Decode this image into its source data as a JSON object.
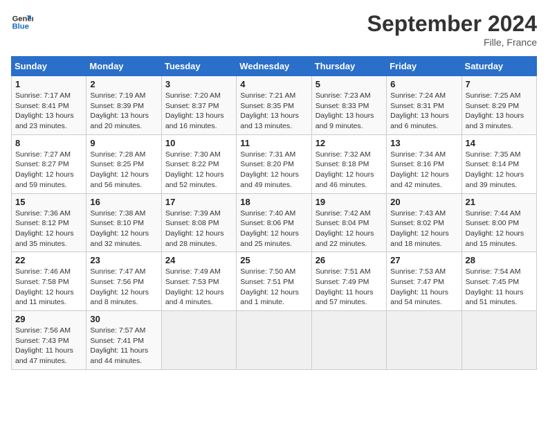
{
  "header": {
    "logo_line1": "General",
    "logo_line2": "Blue",
    "month": "September 2024",
    "location": "Fille, France"
  },
  "weekdays": [
    "Sunday",
    "Monday",
    "Tuesday",
    "Wednesday",
    "Thursday",
    "Friday",
    "Saturday"
  ],
  "weeks": [
    [
      {
        "day": "1",
        "detail": "Sunrise: 7:17 AM\nSunset: 8:41 PM\nDaylight: 13 hours\nand 23 minutes."
      },
      {
        "day": "2",
        "detail": "Sunrise: 7:19 AM\nSunset: 8:39 PM\nDaylight: 13 hours\nand 20 minutes."
      },
      {
        "day": "3",
        "detail": "Sunrise: 7:20 AM\nSunset: 8:37 PM\nDaylight: 13 hours\nand 16 minutes."
      },
      {
        "day": "4",
        "detail": "Sunrise: 7:21 AM\nSunset: 8:35 PM\nDaylight: 13 hours\nand 13 minutes."
      },
      {
        "day": "5",
        "detail": "Sunrise: 7:23 AM\nSunset: 8:33 PM\nDaylight: 13 hours\nand 9 minutes."
      },
      {
        "day": "6",
        "detail": "Sunrise: 7:24 AM\nSunset: 8:31 PM\nDaylight: 13 hours\nand 6 minutes."
      },
      {
        "day": "7",
        "detail": "Sunrise: 7:25 AM\nSunset: 8:29 PM\nDaylight: 13 hours\nand 3 minutes."
      }
    ],
    [
      {
        "day": "8",
        "detail": "Sunrise: 7:27 AM\nSunset: 8:27 PM\nDaylight: 12 hours\nand 59 minutes."
      },
      {
        "day": "9",
        "detail": "Sunrise: 7:28 AM\nSunset: 8:25 PM\nDaylight: 12 hours\nand 56 minutes."
      },
      {
        "day": "10",
        "detail": "Sunrise: 7:30 AM\nSunset: 8:22 PM\nDaylight: 12 hours\nand 52 minutes."
      },
      {
        "day": "11",
        "detail": "Sunrise: 7:31 AM\nSunset: 8:20 PM\nDaylight: 12 hours\nand 49 minutes."
      },
      {
        "day": "12",
        "detail": "Sunrise: 7:32 AM\nSunset: 8:18 PM\nDaylight: 12 hours\nand 46 minutes."
      },
      {
        "day": "13",
        "detail": "Sunrise: 7:34 AM\nSunset: 8:16 PM\nDaylight: 12 hours\nand 42 minutes."
      },
      {
        "day": "14",
        "detail": "Sunrise: 7:35 AM\nSunset: 8:14 PM\nDaylight: 12 hours\nand 39 minutes."
      }
    ],
    [
      {
        "day": "15",
        "detail": "Sunrise: 7:36 AM\nSunset: 8:12 PM\nDaylight: 12 hours\nand 35 minutes."
      },
      {
        "day": "16",
        "detail": "Sunrise: 7:38 AM\nSunset: 8:10 PM\nDaylight: 12 hours\nand 32 minutes."
      },
      {
        "day": "17",
        "detail": "Sunrise: 7:39 AM\nSunset: 8:08 PM\nDaylight: 12 hours\nand 28 minutes."
      },
      {
        "day": "18",
        "detail": "Sunrise: 7:40 AM\nSunset: 8:06 PM\nDaylight: 12 hours\nand 25 minutes."
      },
      {
        "day": "19",
        "detail": "Sunrise: 7:42 AM\nSunset: 8:04 PM\nDaylight: 12 hours\nand 22 minutes."
      },
      {
        "day": "20",
        "detail": "Sunrise: 7:43 AM\nSunset: 8:02 PM\nDaylight: 12 hours\nand 18 minutes."
      },
      {
        "day": "21",
        "detail": "Sunrise: 7:44 AM\nSunset: 8:00 PM\nDaylight: 12 hours\nand 15 minutes."
      }
    ],
    [
      {
        "day": "22",
        "detail": "Sunrise: 7:46 AM\nSunset: 7:58 PM\nDaylight: 12 hours\nand 11 minutes."
      },
      {
        "day": "23",
        "detail": "Sunrise: 7:47 AM\nSunset: 7:56 PM\nDaylight: 12 hours\nand 8 minutes."
      },
      {
        "day": "24",
        "detail": "Sunrise: 7:49 AM\nSunset: 7:53 PM\nDaylight: 12 hours\nand 4 minutes."
      },
      {
        "day": "25",
        "detail": "Sunrise: 7:50 AM\nSunset: 7:51 PM\nDaylight: 12 hours\nand 1 minute."
      },
      {
        "day": "26",
        "detail": "Sunrise: 7:51 AM\nSunset: 7:49 PM\nDaylight: 11 hours\nand 57 minutes."
      },
      {
        "day": "27",
        "detail": "Sunrise: 7:53 AM\nSunset: 7:47 PM\nDaylight: 11 hours\nand 54 minutes."
      },
      {
        "day": "28",
        "detail": "Sunrise: 7:54 AM\nSunset: 7:45 PM\nDaylight: 11 hours\nand 51 minutes."
      }
    ],
    [
      {
        "day": "29",
        "detail": "Sunrise: 7:56 AM\nSunset: 7:43 PM\nDaylight: 11 hours\nand 47 minutes."
      },
      {
        "day": "30",
        "detail": "Sunrise: 7:57 AM\nSunset: 7:41 PM\nDaylight: 11 hours\nand 44 minutes."
      },
      {
        "day": "",
        "detail": ""
      },
      {
        "day": "",
        "detail": ""
      },
      {
        "day": "",
        "detail": ""
      },
      {
        "day": "",
        "detail": ""
      },
      {
        "day": "",
        "detail": ""
      }
    ]
  ]
}
